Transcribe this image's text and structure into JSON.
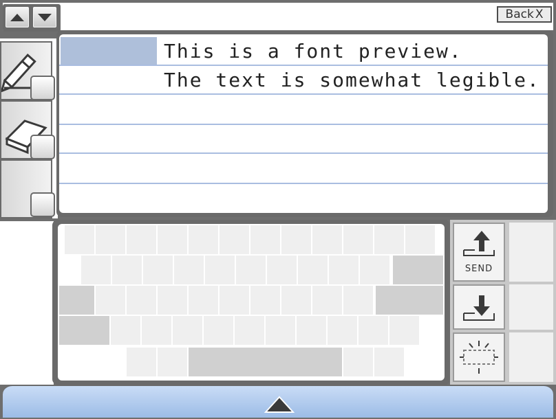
{
  "toolbar": {
    "scroll_up_icon": "triangle-up-icon",
    "scroll_down_icon": "triangle-down-icon",
    "back_label": "Back",
    "back_close_glyph": "X"
  },
  "tools": [
    {
      "name": "pencil",
      "icon": "pencil-icon"
    },
    {
      "name": "eraser",
      "icon": "eraser-icon"
    },
    {
      "name": "empty",
      "icon": ""
    }
  ],
  "text_area": {
    "lines": [
      "This is a font preview.",
      "The text is somewhat legible."
    ]
  },
  "actions": {
    "send_label": "SEND",
    "send_icon": "upload-arrow-icon",
    "receive_icon": "download-arrow-icon",
    "clear_icon": "sparkle-clear-icon"
  },
  "bottom": {
    "expand_icon": "triangle-up-icon"
  },
  "colors": {
    "frame": "#6a6a6a",
    "highlight": "#aebfda",
    "rule": "#a9bde0",
    "bottom_bar": "#9cbce6"
  }
}
